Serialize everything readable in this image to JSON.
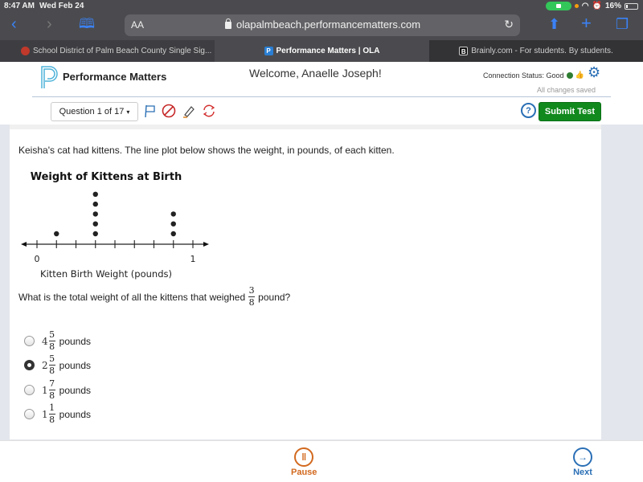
{
  "status_bar": {
    "time": "8:47 AM",
    "date": "Wed Feb 24",
    "battery": "16%"
  },
  "browser": {
    "url": "olapalmbeach.performancematters.com",
    "aa_label": "AA",
    "tabs": [
      {
        "title": "School District of Palm Beach County Single Sig...",
        "active": false
      },
      {
        "title": "Performance Matters | OLA",
        "active": true
      },
      {
        "title": "Brainly.com - For students. By students.",
        "active": false
      }
    ]
  },
  "header": {
    "logo_text": "Performance Matters",
    "welcome": "Welcome, Anaelle Joseph!",
    "connection_status": "Connection Status: Good",
    "save_status": "All changes saved",
    "question_selector": "Question 1 of 17",
    "help_label": "?",
    "submit_label": "Submit Test",
    "colors": {
      "submit": "#11891d",
      "accent": "#2a6fb5"
    }
  },
  "question": {
    "prompt": "Keisha's cat had kittens.  The line plot below shows the weight, in pounds, of each kitten.",
    "stem_before": "What is the total weight of all the kittens that weighed",
    "stem_fraction": {
      "num": "3",
      "den": "8"
    },
    "stem_after": "pound?",
    "choices": [
      {
        "whole": "4",
        "num": "5",
        "den": "8",
        "unit": "pounds",
        "selected": false
      },
      {
        "whole": "2",
        "num": "5",
        "den": "8",
        "unit": "pounds",
        "selected": true
      },
      {
        "whole": "1",
        "num": "7",
        "den": "8",
        "unit": "pounds",
        "selected": false
      },
      {
        "whole": "1",
        "num": "1",
        "den": "8",
        "unit": "pounds",
        "selected": false
      }
    ]
  },
  "chart_data": {
    "type": "scatter",
    "title": "Weight of Kittens at Birth",
    "xlabel": "Kitten Birth Weight (pounds)",
    "xlim": [
      0,
      1
    ],
    "tick_step": 0.125,
    "tick_labels": [
      {
        "value": 0,
        "label": "0"
      },
      {
        "value": 1,
        "label": "1"
      }
    ],
    "points": [
      {
        "x": 0.125,
        "count": 1
      },
      {
        "x": 0.375,
        "count": 5
      },
      {
        "x": 0.875,
        "count": 3
      }
    ]
  },
  "footer": {
    "pause_label": "Pause",
    "next_label": "Next"
  }
}
